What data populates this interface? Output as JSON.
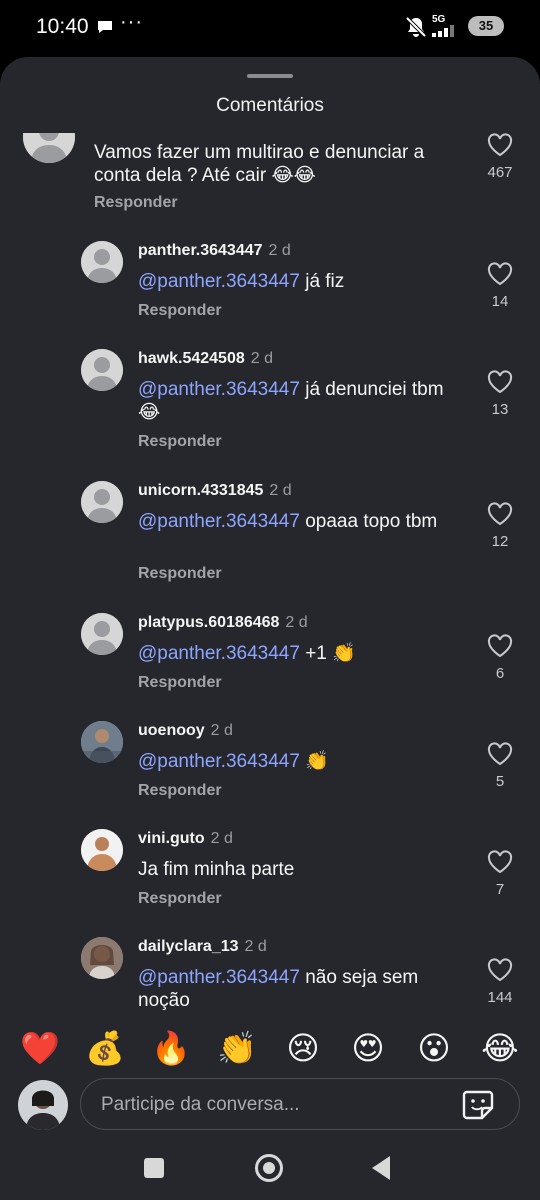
{
  "status": {
    "time": "10:40",
    "network": "5G",
    "battery": "35",
    "more": "···"
  },
  "sheet": {
    "title": "Comentários",
    "reply_label": "Responder"
  },
  "comments": [
    {
      "user": "",
      "time": "",
      "text_plain": "Vamos fazer um multirao e denunciar a conta dela ? Até cair 😂😂",
      "likes": "467"
    },
    {
      "user": "panther.3643447",
      "time": "2 d",
      "mention": "@panther.3643447",
      "text": " já fiz",
      "likes": "14"
    },
    {
      "user": "hawk.5424508",
      "time": "2 d",
      "mention": "@panther.3643447",
      "text": " já denunciei tbm 😂",
      "likes": "13"
    },
    {
      "user": "unicorn.4331845",
      "time": "2 d",
      "mention": "@panther.3643447",
      "text": " opaaa topo tbm",
      "likes": "12"
    },
    {
      "user": "platypus.60186468",
      "time": "2 d",
      "mention": "@panther.3643447",
      "text": " +1 👏",
      "likes": "6"
    },
    {
      "user": "uoenooy",
      "time": "2 d",
      "mention": "@panther.3643447",
      "text": " 👏",
      "likes": "5"
    },
    {
      "user": "vini.guto",
      "time": "2 d",
      "text_plain": "Ja fim minha parte",
      "likes": "7"
    },
    {
      "user": "dailyclara_13",
      "time": "2 d",
      "mention": "@panther.3643447",
      "text": " não seja sem noção",
      "likes": "144"
    }
  ],
  "emojis": [
    "❤️",
    "💰",
    "🔥",
    "👏",
    "😢",
    "😍",
    "😮",
    "😂"
  ],
  "input": {
    "placeholder": "Participe da conversa..."
  },
  "icons": [
    "heart-icon",
    "sticker-icon",
    "message-icon",
    "mute-icon",
    "signal-icon"
  ],
  "colors": {
    "sheet_bg": "#25272c",
    "mention": "#8ea5ff",
    "muted": "#a2a4aa"
  }
}
